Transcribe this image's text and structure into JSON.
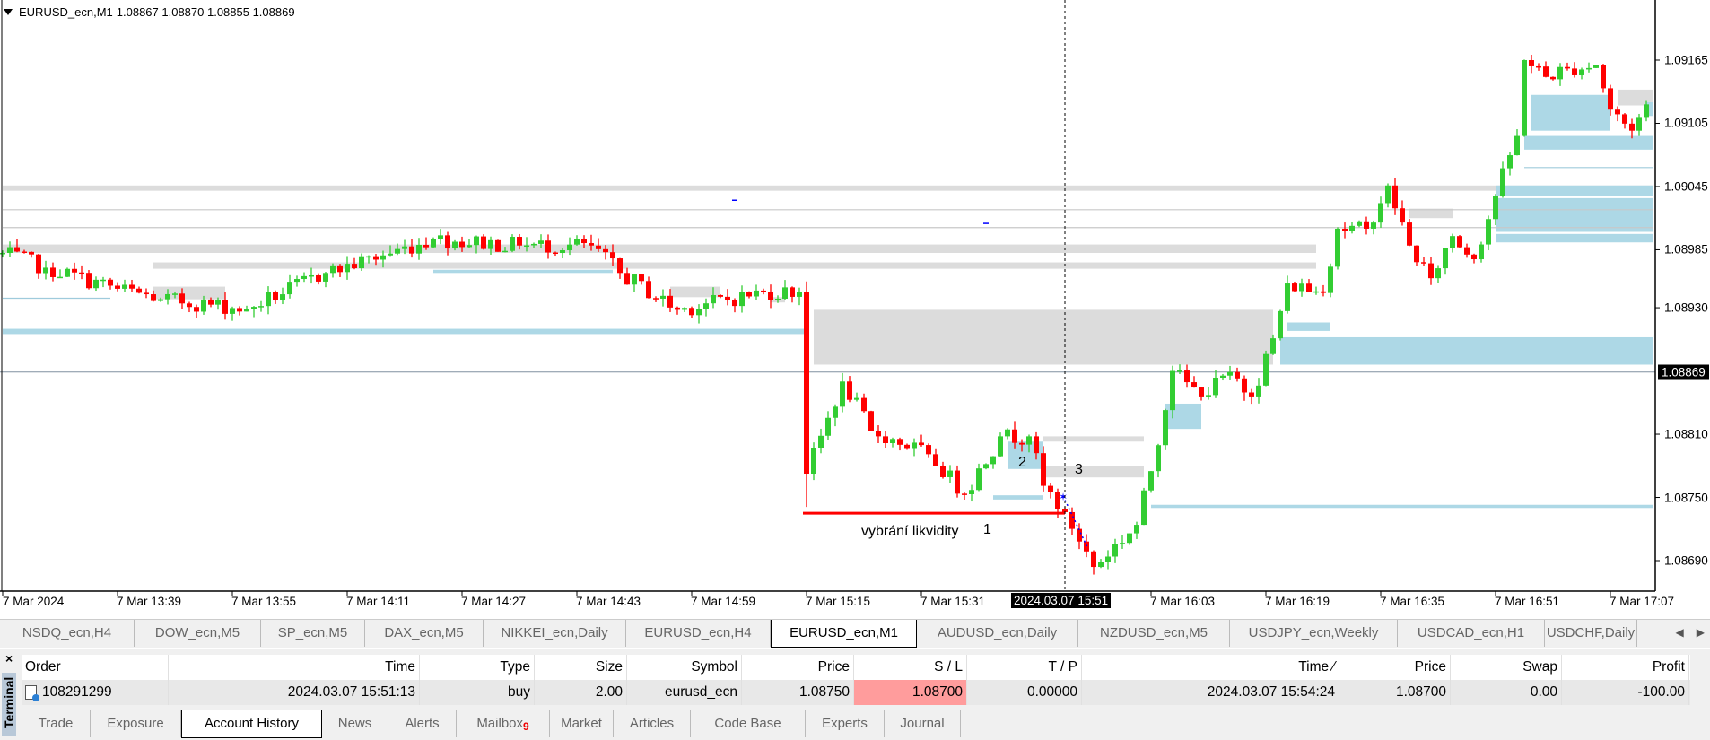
{
  "header": {
    "symbol": "EURUSD_ecn,M1",
    "ohlc": "1.08867 1.08870 1.08855 1.08869"
  },
  "price_axis": {
    "labels": [
      "1.09165",
      "1.09105",
      "1.09045",
      "1.08985",
      "1.08930",
      "1.08810",
      "1.08750",
      "1.08690"
    ],
    "values": [
      1.09165,
      1.09105,
      1.09045,
      1.08985,
      1.0893,
      1.0881,
      1.0875,
      1.0869
    ],
    "current": "1.08869",
    "current_value": 1.08869
  },
  "time_axis": {
    "labels": [
      "7 Mar 2024",
      "7 Mar 13:39",
      "7 Mar 13:55",
      "7 Mar 14:11",
      "7 Mar 14:27",
      "7 Mar 14:43",
      "7 Mar 14:59",
      "7 Mar 15:15",
      "7 Mar 15:31",
      "7 Mar 16:03",
      "7 Mar 16:19",
      "7 Mar 16:35",
      "7 Mar 16:51",
      "7 Mar 17:07"
    ],
    "times": [
      "13:23",
      "13:39",
      "13:55",
      "14:11",
      "14:27",
      "14:43",
      "14:59",
      "15:15",
      "15:31",
      "16:03",
      "16:19",
      "16:35",
      "16:51",
      "17:07"
    ],
    "crosshair": "2024.03.07 15:51",
    "crosshair_time": "15:51"
  },
  "annotations": {
    "liquidity": "vybrání likvidity",
    "n1": "1",
    "n2": "2",
    "n3": "3"
  },
  "colors": {
    "bull": "#32cd32",
    "bear": "#ff0000",
    "gray_zone": "#dcdcdc",
    "blue_zone": "#add8e6",
    "liquidity_line": "#ff0000",
    "sl_cell": "#ff9c9c"
  },
  "chart_data": {
    "type": "candlestick",
    "timeframe": "M1",
    "keypoints": [
      [
        "13:23",
        1.08982
      ],
      [
        "13:29",
        1.08968
      ],
      [
        "13:39",
        1.08948
      ],
      [
        "13:45",
        1.08938
      ],
      [
        "13:57",
        1.08929
      ],
      [
        "14:08",
        1.08963
      ],
      [
        "14:23",
        1.08995
      ],
      [
        "14:35",
        1.08989
      ],
      [
        "14:45",
        1.08989
      ],
      [
        "14:49",
        1.08963
      ],
      [
        "14:57",
        1.08928
      ],
      [
        "15:09",
        1.08945
      ],
      [
        "15:14",
        1.08945
      ],
      [
        "15:15",
        1.08772
      ],
      [
        "15:20",
        1.0886
      ],
      [
        "15:24",
        1.08813
      ],
      [
        "15:32",
        1.08791
      ],
      [
        "15:37",
        1.08753
      ],
      [
        "15:42",
        1.08808
      ],
      [
        "15:46",
        1.08808
      ],
      [
        "15:48",
        1.08761
      ],
      [
        "15:51",
        1.08736
      ],
      [
        "15:55",
        1.08684
      ],
      [
        "16:01",
        1.08724
      ],
      [
        "16:03",
        1.08775
      ],
      [
        "16:06",
        1.0887
      ],
      [
        "16:10",
        1.08845
      ],
      [
        "16:14",
        1.08869
      ],
      [
        "16:17",
        1.08845
      ],
      [
        "16:20",
        1.08901
      ],
      [
        "16:22",
        1.08953
      ],
      [
        "16:27",
        1.08944
      ],
      [
        "16:29",
        1.09005
      ],
      [
        "16:33",
        1.09005
      ],
      [
        "16:36",
        1.09046
      ],
      [
        "16:39",
        1.08989
      ],
      [
        "16:42",
        1.08958
      ],
      [
        "16:45",
        1.08998
      ],
      [
        "16:48",
        1.08976
      ],
      [
        "16:51",
        1.09036
      ],
      [
        "16:54",
        1.09093
      ],
      [
        "16:55",
        1.09165
      ],
      [
        "16:58",
        1.09149
      ],
      [
        "17:01",
        1.09157
      ],
      [
        "17:05",
        1.0916
      ],
      [
        "17:07",
        1.09118
      ],
      [
        "17:10",
        1.09098
      ],
      [
        "17:12",
        1.09123
      ]
    ],
    "spikes": [
      {
        "time": "15:15",
        "low": 1.08741,
        "high": 1.08955
      }
    ],
    "zones": [
      {
        "t1": "13:23",
        "t2": "17:13",
        "p1": 1.09046,
        "p2": 1.09041,
        "kind": "gray"
      },
      {
        "t1": "13:23",
        "t2": "16:26",
        "p1": 1.0899,
        "p2": 1.08982,
        "kind": "gray"
      },
      {
        "t1": "13:44",
        "t2": "16:26",
        "p1": 1.08973,
        "p2": 1.08967,
        "kind": "gray"
      },
      {
        "t1": "15:16",
        "t2": "16:20",
        "p1": 1.08928,
        "p2": 1.08876,
        "kind": "gray"
      },
      {
        "t1": "15:48",
        "t2": "16:02",
        "p1": 1.08808,
        "p2": 1.08803,
        "kind": "gray"
      },
      {
        "t1": "15:48",
        "t2": "16:02",
        "p1": 1.0878,
        "p2": 1.08769,
        "kind": "gray"
      },
      {
        "t1": "17:08",
        "t2": "17:13",
        "p1": 1.09137,
        "p2": 1.09122,
        "kind": "gray"
      },
      {
        "t1": "13:44",
        "t2": "13:54",
        "p1": 1.0895,
        "p2": 1.08938,
        "kind": "gray"
      },
      {
        "t1": "14:56",
        "t2": "15:03",
        "p1": 1.0895,
        "p2": 1.0894,
        "kind": "gray"
      },
      {
        "t1": "15:10",
        "t2": "15:12",
        "p1": 1.0894,
        "p2": 1.08935,
        "kind": "gray"
      },
      {
        "t1": "16:39",
        "t2": "16:45",
        "p1": 1.09024,
        "p2": 1.09015,
        "kind": "gray"
      },
      {
        "t1": "13:23",
        "t2": "15:15",
        "p1": 1.0891,
        "p2": 1.08905,
        "kind": "blue"
      },
      {
        "t1": "14:23",
        "t2": "14:48",
        "p1": 1.08966,
        "p2": 1.08963,
        "kind": "blue"
      },
      {
        "t1": "16:21",
        "t2": "17:13",
        "p1": 1.08902,
        "p2": 1.08876,
        "kind": "blue"
      },
      {
        "t1": "16:22",
        "t2": "16:28",
        "p1": 1.08916,
        "p2": 1.08908,
        "kind": "blue"
      },
      {
        "t1": "16:51",
        "t2": "17:13",
        "p1": 1.09046,
        "p2": 1.09036,
        "kind": "blue"
      },
      {
        "t1": "16:51",
        "t2": "17:13",
        "p1": 1.09034,
        "p2": 1.09002,
        "kind": "blue"
      },
      {
        "t1": "16:51",
        "t2": "17:13",
        "p1": 1.09,
        "p2": 1.08992,
        "kind": "blue"
      },
      {
        "t1": "16:55",
        "t2": "17:13",
        "p1": 1.09093,
        "p2": 1.0908,
        "kind": "blue"
      },
      {
        "t1": "16:56",
        "t2": "17:07",
        "p1": 1.09132,
        "p2": 1.09098,
        "kind": "blue"
      },
      {
        "t1": "17:12",
        "t2": "17:13",
        "p1": 1.09125,
        "p2": 1.09112,
        "kind": "blue"
      },
      {
        "t1": "16:05",
        "t2": "16:10",
        "p1": 1.08839,
        "p2": 1.08815,
        "kind": "blue"
      },
      {
        "t1": "16:03",
        "t2": "17:13",
        "p1": 1.08743,
        "p2": 1.0874,
        "kind": "blue"
      },
      {
        "t1": "15:43",
        "t2": "15:48",
        "p1": 1.08803,
        "p2": 1.08777,
        "kind": "blue"
      },
      {
        "t1": "15:41",
        "t2": "15:48",
        "p1": 1.08752,
        "p2": 1.08748,
        "kind": "blue"
      }
    ],
    "lines": [
      {
        "t1": "13:23",
        "t2": "17:13",
        "p": 1.09023,
        "kind": "gray-thin"
      },
      {
        "t1": "13:23",
        "t2": "17:13",
        "p": 1.09006,
        "kind": "gray-thin"
      },
      {
        "t1": "13:23",
        "t2": "13:38",
        "p": 1.08939,
        "kind": "blue-thin"
      },
      {
        "t1": "16:55",
        "t2": "17:13",
        "p": 1.09063,
        "kind": "blue-thin"
      }
    ],
    "liquidity_line": {
      "t1": "15:15",
      "t2": "15:51",
      "p": 1.08735
    },
    "markers": [
      {
        "time": "15:05",
        "p": 1.09032
      },
      {
        "time": "15:40",
        "p": 1.0901
      }
    ]
  },
  "chart_tabs": [
    {
      "label": "NSDQ_ecn,H4"
    },
    {
      "label": "DOW_ecn,M5"
    },
    {
      "label": "SP_ecn,M5"
    },
    {
      "label": "DAX_ecn,M5"
    },
    {
      "label": "NIKKEI_ecn,Daily"
    },
    {
      "label": "EURUSD_ecn,H4"
    },
    {
      "label": "EURUSD_ecn,M1",
      "active": true
    },
    {
      "label": "AUDUSD_ecn,Daily"
    },
    {
      "label": "NZDUSD_ecn,M5"
    },
    {
      "label": "USDJPY_ecn,Weekly"
    },
    {
      "label": "USDCAD_ecn,H1"
    },
    {
      "label": "USDCHF,Daily"
    }
  ],
  "terminal": {
    "title": "Terminal",
    "close": "×",
    "columns": [
      "Order",
      "Time",
      "Type",
      "Size",
      "Symbol",
      "Price",
      "S / L",
      "T / P",
      "Time ⁄",
      "Price",
      "Swap",
      "Profit"
    ],
    "rows": [
      [
        "108291299",
        "2024.03.07 15:51:13",
        "buy",
        "2.00",
        "eurusd_ecn",
        "1.08750",
        "1.08700",
        "0.00000",
        "2024.03.07 15:54:24",
        "1.08700",
        "0.00",
        "-100.00"
      ]
    ],
    "tabs": [
      {
        "label": "Trade"
      },
      {
        "label": "Exposure"
      },
      {
        "label": "Account History",
        "active": true
      },
      {
        "label": "News"
      },
      {
        "label": "Alerts"
      },
      {
        "label": "Mailbox",
        "badge": "9"
      },
      {
        "label": "Market"
      },
      {
        "label": "Articles"
      },
      {
        "label": "Code Base"
      },
      {
        "label": "Experts"
      },
      {
        "label": "Journal"
      }
    ]
  }
}
